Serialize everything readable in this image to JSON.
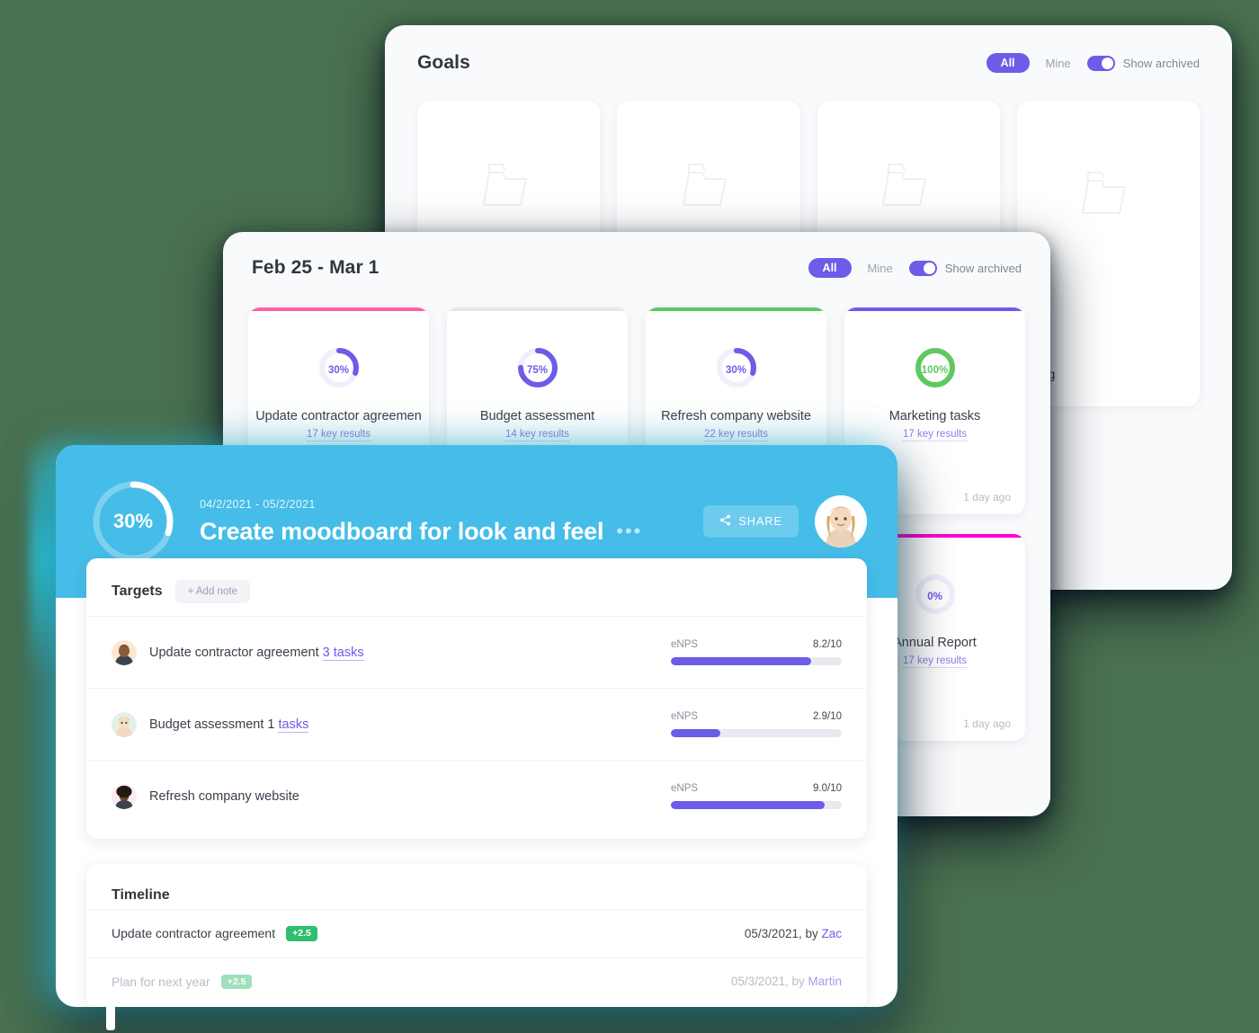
{
  "background_color": "#4a7150",
  "colors": {
    "accent_purple": "#6c5ce7",
    "accent_blue": "#45bde8",
    "accent_green": "#5fc95f",
    "accent_pink": "#ff5fa2",
    "accent_magenta": "#ff00d0",
    "glow_cyan": "#2ee7ff",
    "badge_green": "#2fbf6e"
  },
  "goals_panel": {
    "title": "Goals",
    "filters": {
      "all": "All",
      "mine": "Mine",
      "show_archived": "Show archived",
      "archived_on": true
    },
    "folders": [
      {
        "icon": "folder-icon",
        "label": ""
      },
      {
        "icon": "folder-icon",
        "label": ""
      },
      {
        "icon": "folder-icon",
        "label": ""
      },
      {
        "icon": "folder-icon",
        "label": "ting"
      }
    ]
  },
  "week_panel": {
    "title": "Feb 25 - Mar 1",
    "filters": {
      "all": "All",
      "mine": "Mine",
      "show_archived": "Show archived",
      "archived_on": true
    },
    "cards": [
      {
        "percent": "30%",
        "percent_value": 30,
        "name": "Update contractor agreemen",
        "key_results": "17 key results",
        "accent": "#ff5fa2",
        "ring_color": "#6c5ce7",
        "updated": ""
      },
      {
        "percent": "75%",
        "percent_value": 75,
        "name": "Budget assessment",
        "key_results": "14 key results",
        "accent": "#e3e5ea",
        "ring_color": "#6c5ce7",
        "updated": ""
      },
      {
        "percent": "30%",
        "percent_value": 30,
        "name": "Refresh company website",
        "key_results": "22 key results",
        "accent": "#5fc95f",
        "ring_color": "#6c5ce7",
        "updated": ""
      },
      {
        "percent": "100%",
        "percent_value": 100,
        "name": "Marketing tasks",
        "key_results": "17 key results",
        "accent": "#6c5ce7",
        "ring_color": "#5fc95f",
        "updated": "1 day ago"
      }
    ],
    "cards_row2": [
      {
        "percent": "0%",
        "percent_value": 0,
        "name": "Annual Report",
        "key_results": "17 key results",
        "accent": "#ff00d0",
        "ring_color": "#6c5ce7",
        "updated": "1 day ago"
      }
    ]
  },
  "detail_panel": {
    "progress": "30%",
    "progress_value": 30,
    "date_range": "04/2/2021 - 05/2/2021",
    "title": "Create moodboard for look and feel",
    "menu_dots": "•••",
    "share_label": "SHARE",
    "avatar": "user-avatar",
    "targets": {
      "title": "Targets",
      "add_note_label": "+ Add note",
      "rows": [
        {
          "avatar": "avatar-male-1",
          "name": "Update contractor agreement",
          "tasks": "3 tasks",
          "metric_label": "eNPS",
          "score": "8.2/10",
          "score_value": 82
        },
        {
          "avatar": "avatar-female-1",
          "name": "Budget assessment 1",
          "tasks": "tasks",
          "metric_label": "eNPS",
          "score": "2.9/10",
          "score_value": 29
        },
        {
          "avatar": "avatar-female-2",
          "name": "Refresh company website",
          "tasks": "",
          "metric_label": "eNPS",
          "score": "9.0/10",
          "score_value": 90
        }
      ]
    },
    "timeline": {
      "title": "Timeline",
      "rows": [
        {
          "name": "Update contractor agreement",
          "badge": "+2.5",
          "date": "05/3/2021, by ",
          "author": "Zac",
          "faded": false
        },
        {
          "name": "Plan for next year",
          "badge": "+2.5",
          "date": "05/3/2021, by ",
          "author": "Martin",
          "faded": true
        }
      ]
    }
  }
}
